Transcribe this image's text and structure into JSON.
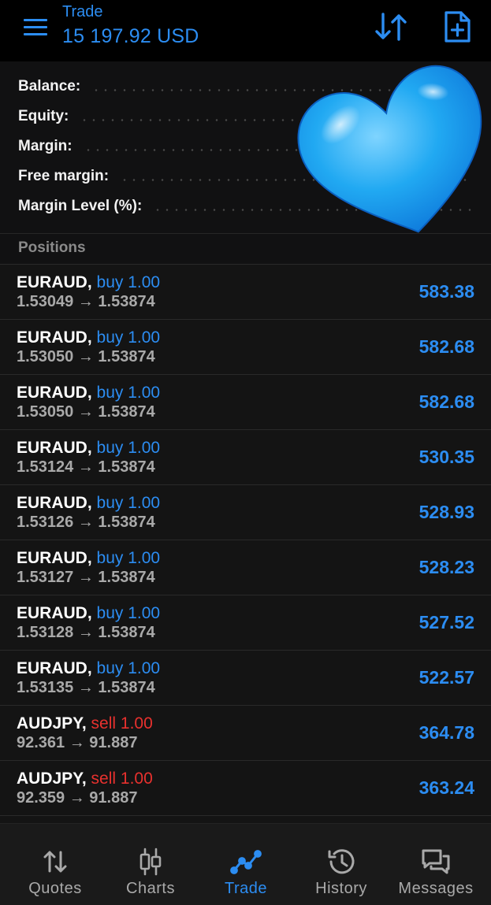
{
  "header": {
    "section_label": "Trade",
    "balance_display": "15 197.92 USD"
  },
  "summary": {
    "rows": [
      {
        "label": "Balance:"
      },
      {
        "label": "Equity:"
      },
      {
        "label": "Margin:"
      },
      {
        "label": "Free margin:"
      },
      {
        "label": "Margin Level (%):"
      }
    ]
  },
  "positions": {
    "title": "Positions",
    "items": [
      {
        "symbol": "EURAUD,",
        "direction": "buy",
        "volume": "1.00",
        "open_price": "1.53049",
        "arrow": "→",
        "current_price": "1.53874",
        "profit": "583.38"
      },
      {
        "symbol": "EURAUD,",
        "direction": "buy",
        "volume": "1.00",
        "open_price": "1.53050",
        "arrow": "→",
        "current_price": "1.53874",
        "profit": "582.68"
      },
      {
        "symbol": "EURAUD,",
        "direction": "buy",
        "volume": "1.00",
        "open_price": "1.53050",
        "arrow": "→",
        "current_price": "1.53874",
        "profit": "582.68"
      },
      {
        "symbol": "EURAUD,",
        "direction": "buy",
        "volume": "1.00",
        "open_price": "1.53124",
        "arrow": "→",
        "current_price": "1.53874",
        "profit": "530.35"
      },
      {
        "symbol": "EURAUD,",
        "direction": "buy",
        "volume": "1.00",
        "open_price": "1.53126",
        "arrow": "→",
        "current_price": "1.53874",
        "profit": "528.93"
      },
      {
        "symbol": "EURAUD,",
        "direction": "buy",
        "volume": "1.00",
        "open_price": "1.53127",
        "arrow": "→",
        "current_price": "1.53874",
        "profit": "528.23"
      },
      {
        "symbol": "EURAUD,",
        "direction": "buy",
        "volume": "1.00",
        "open_price": "1.53128",
        "arrow": "→",
        "current_price": "1.53874",
        "profit": "527.52"
      },
      {
        "symbol": "EURAUD,",
        "direction": "buy",
        "volume": "1.00",
        "open_price": "1.53135",
        "arrow": "→",
        "current_price": "1.53874",
        "profit": "522.57"
      },
      {
        "symbol": "AUDJPY,",
        "direction": "sell",
        "volume": "1.00",
        "open_price": "92.361",
        "arrow": "→",
        "current_price": "91.887",
        "profit": "364.78"
      },
      {
        "symbol": "AUDJPY,",
        "direction": "sell",
        "volume": "1.00",
        "open_price": "92.359",
        "arrow": "→",
        "current_price": "91.887",
        "profit": "363.24"
      }
    ]
  },
  "nav": {
    "items": [
      {
        "label": "Quotes",
        "icon": "quotes-arrows-icon"
      },
      {
        "label": "Charts",
        "icon": "candlestick-chart-icon"
      },
      {
        "label": "Trade",
        "icon": "trade-trend-icon",
        "active": true
      },
      {
        "label": "History",
        "icon": "history-clock-icon"
      },
      {
        "label": "Messages",
        "icon": "messages-chat-icon"
      }
    ]
  },
  "colors": {
    "accent_blue": "#2c8df2",
    "sell_red": "#e8312e",
    "background": "#111112",
    "heart_blue": "#1fa6f0"
  }
}
